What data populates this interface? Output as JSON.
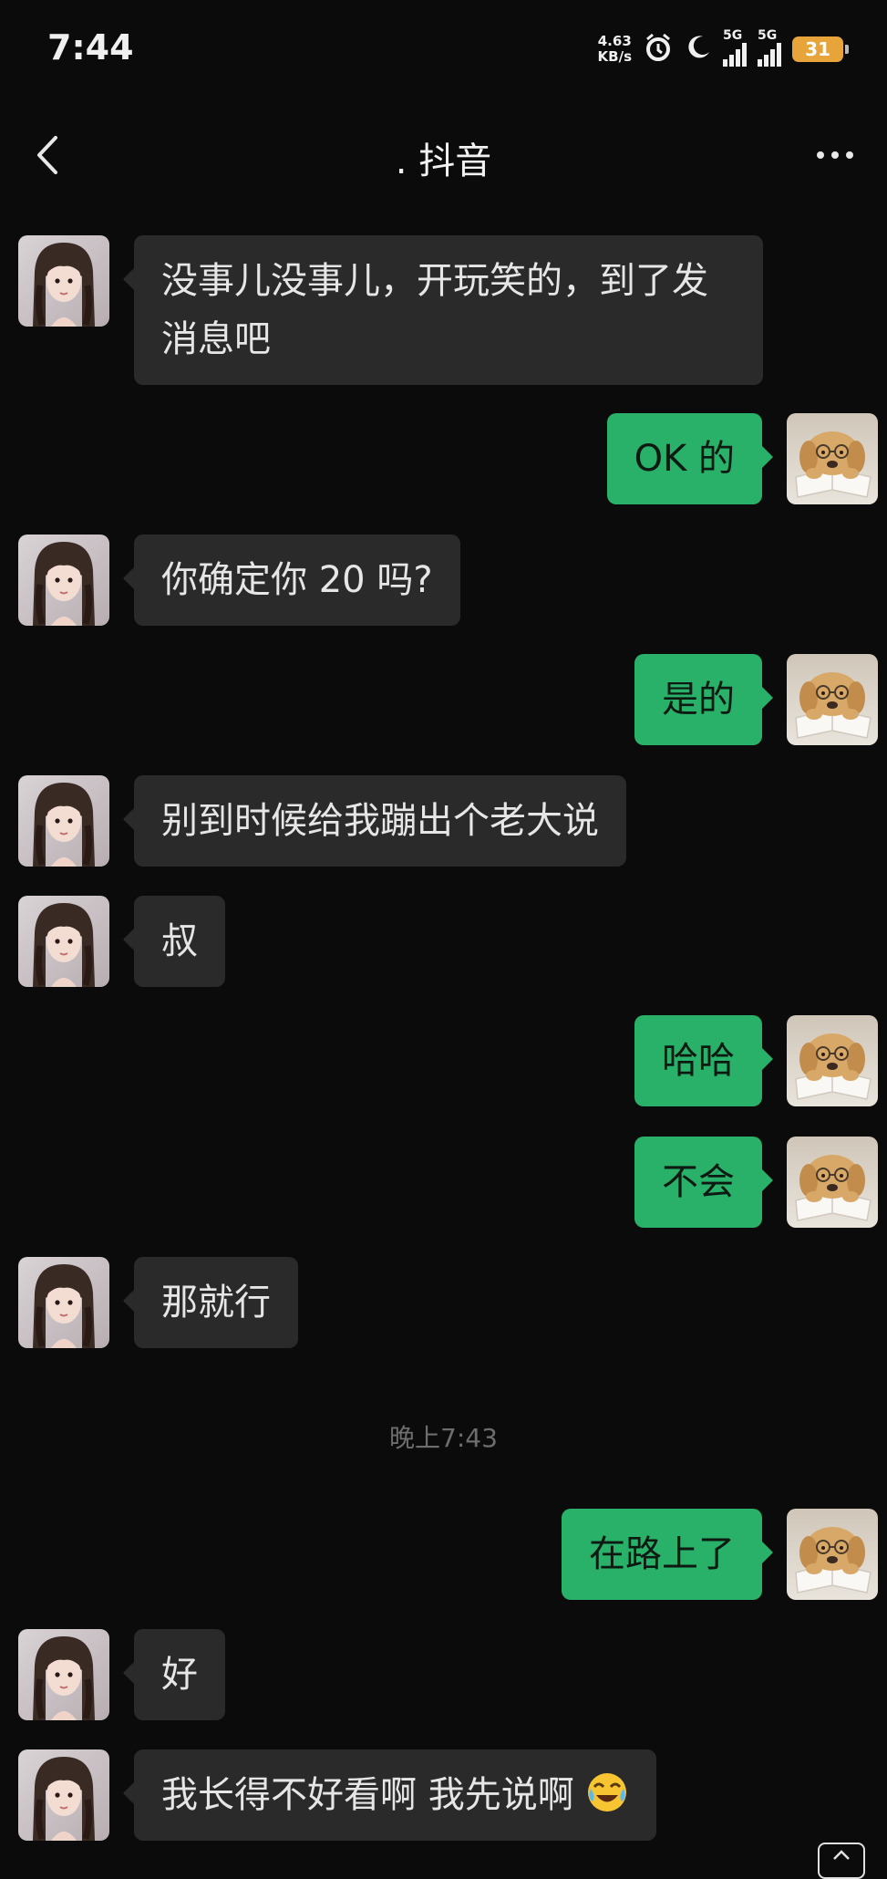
{
  "status_bar": {
    "time": "7:44",
    "net_speed_value": "4.63",
    "net_speed_unit": "KB/s",
    "signal_1_label": "5G",
    "signal_2_label": "5G",
    "battery": "31",
    "battery_color": "#e6a43a"
  },
  "header": {
    "title": ". 抖音",
    "back_icon": "chevron-left-icon",
    "more_icon": "more-dots-icon"
  },
  "colors": {
    "incoming_bubble": "#2a2a2a",
    "outgoing_bubble": "#29b069",
    "background": "#0b0b0b"
  },
  "messages": [
    {
      "side": "in",
      "text": "没事儿没事儿，开玩笑的，到了发消息吧"
    },
    {
      "side": "out",
      "text": "OK 的"
    },
    {
      "side": "in",
      "text": "你确定你 20 吗?"
    },
    {
      "side": "out",
      "text": "是的"
    },
    {
      "side": "in",
      "text": "别到时候给我蹦出个老大说"
    },
    {
      "side": "in",
      "text": "叔"
    },
    {
      "side": "out",
      "text": "哈哈"
    },
    {
      "side": "out",
      "text": "不会"
    },
    {
      "side": "in",
      "text": "那就行"
    },
    {
      "side": "out",
      "text": "在路上了"
    },
    {
      "side": "in",
      "text": "好"
    },
    {
      "side": "in",
      "text": "我长得不好看啊 我先说啊",
      "emoji": "laughing-crying-emoji"
    }
  ],
  "timestamp": "晚上7:43"
}
